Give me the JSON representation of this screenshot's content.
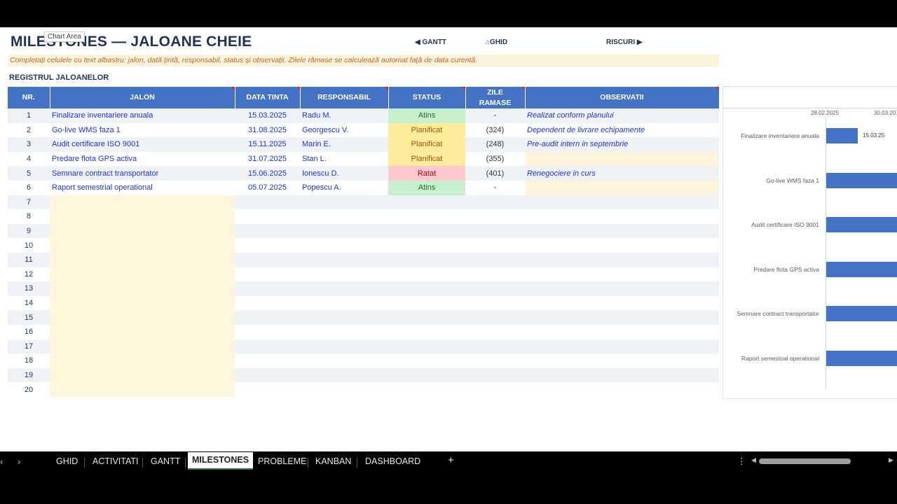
{
  "title": "MILESTONES — JALOANE CHEIE",
  "tooltip": "Chart Area",
  "nav": {
    "gantt": "◀ GANTT",
    "ghid": "⌂GHID",
    "riscuri": "RISCURI ▶"
  },
  "instructions": "Completați celulele cu text albastru: jalon, dată țintă, responsabil, status și observații. Zilele rămase se calculează automat față de data curentă.",
  "section": "REGISTRUL JALOANELOR",
  "columns": {
    "nr": "NR.",
    "jalon": "JALON",
    "data": "DATA TINTA",
    "resp": "RESPONSABIL",
    "status": "STATUS",
    "zile1": "ZILE",
    "zile2": "RAMASE",
    "obs": "OBSERVATII"
  },
  "rows": [
    {
      "nr": "1",
      "jalon": "Finalizare inventariere anuala",
      "data": "15.03.2025",
      "resp": "Radu M.",
      "status": "Atins",
      "zile": "-",
      "obs": "Realizat conform planului"
    },
    {
      "nr": "2",
      "jalon": "Go-live WMS faza 1",
      "data": "31.08.2025",
      "resp": "Georgescu V.",
      "status": "Planificat",
      "zile": "(324)",
      "obs": "Dependent de livrare echipamente"
    },
    {
      "nr": "3",
      "jalon": "Audit certificare ISO 9001",
      "data": "15.11.2025",
      "resp": "Marin E.",
      "status": "Planificat",
      "zile": "(248)",
      "obs": "Pre-audit intern in septembrie"
    },
    {
      "nr": "4",
      "jalon": "Predare flota GPS activa",
      "data": "31.07.2025",
      "resp": "Stan L.",
      "status": "Planificat",
      "zile": "(355)",
      "obs": ""
    },
    {
      "nr": "5",
      "jalon": "Semnare contract transportator",
      "data": "15.06.2025",
      "resp": "Ionescu D.",
      "status": "Ratat",
      "zile": "(401)",
      "obs": "Renegociere in curs"
    },
    {
      "nr": "6",
      "jalon": "Raport semestrial operational",
      "data": "05.07.2025",
      "resp": "Popescu A.",
      "status": "Atins",
      "zile": "-",
      "obs": ""
    },
    {
      "nr": "7"
    },
    {
      "nr": "8"
    },
    {
      "nr": "9"
    },
    {
      "nr": "10"
    },
    {
      "nr": "11"
    },
    {
      "nr": "12"
    },
    {
      "nr": "13"
    },
    {
      "nr": "14"
    },
    {
      "nr": "15"
    },
    {
      "nr": "16"
    },
    {
      "nr": "17"
    },
    {
      "nr": "18"
    },
    {
      "nr": "19"
    },
    {
      "nr": "20"
    }
  ],
  "status_colors": {
    "Atins": "#c6efce",
    "Planificat": "#ffeb9c",
    "Ratat": "#ffc7ce"
  },
  "chart_data": {
    "type": "bar",
    "orientation": "horizontal",
    "x_tick_labels": [
      "28.02.2025",
      "30.03.20"
    ],
    "categories": [
      "Finalizare inventariere anuala",
      "Go-live WMS faza 1",
      "Audit certificare ISO 9001",
      "Predare flota GPS activa",
      "Semnare contract transportator",
      "Raport semestrial operational"
    ],
    "values": [
      "15.03.2025",
      "31.08.2025",
      "15.11.2025",
      "31.07.2025",
      "15.06.2025",
      "05.07.2025"
    ],
    "data_labels": [
      "15.03.25",
      "",
      "",
      "",
      "",
      ""
    ],
    "color": "#4472c4"
  },
  "tabs": [
    "GHID",
    "ACTIVITATI",
    "GANTT",
    "MILESTONES",
    "PROBLEME",
    "KANBAN",
    "DASHBOARD"
  ],
  "active_tab": "MILESTONES",
  "add_tab": "+"
}
